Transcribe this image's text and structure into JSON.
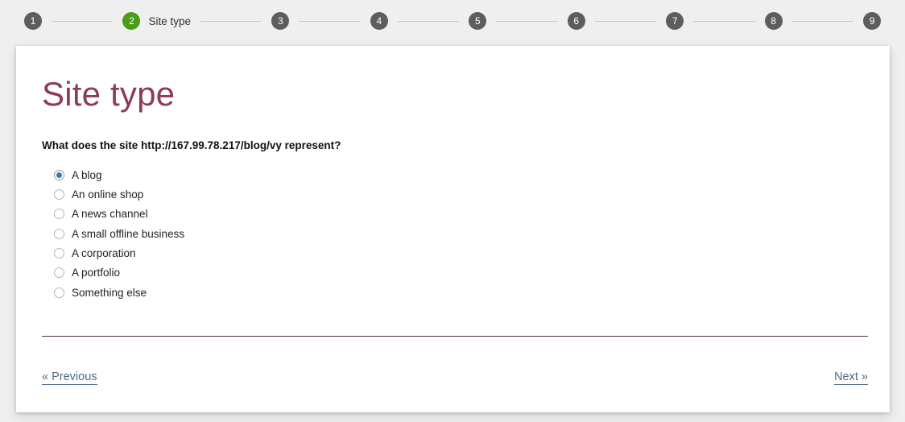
{
  "stepbar": {
    "steps": [
      {
        "number": "1",
        "label": "",
        "state": "pending"
      },
      {
        "number": "2",
        "label": "Site type",
        "state": "active"
      },
      {
        "number": "3",
        "label": "",
        "state": "pending"
      },
      {
        "number": "4",
        "label": "",
        "state": "pending"
      },
      {
        "number": "5",
        "label": "",
        "state": "pending"
      },
      {
        "number": "6",
        "label": "",
        "state": "pending"
      },
      {
        "number": "7",
        "label": "",
        "state": "pending"
      },
      {
        "number": "8",
        "label": "",
        "state": "pending"
      },
      {
        "number": "9",
        "label": "",
        "state": "pending"
      }
    ],
    "active_color": "#4b9c17",
    "pending_color": "#5d5d5d"
  },
  "main": {
    "title": "Site type",
    "title_color": "#8e3a5b",
    "question": "What does the site http://167.99.78.217/blog/vy represent?",
    "options": [
      {
        "label": "A blog",
        "selected": true
      },
      {
        "label": "An online shop",
        "selected": false
      },
      {
        "label": "A news channel",
        "selected": false
      },
      {
        "label": "A small offline business",
        "selected": false
      },
      {
        "label": "A corporation",
        "selected": false
      },
      {
        "label": "A portfolio",
        "selected": false
      },
      {
        "label": "Something else",
        "selected": false
      }
    ],
    "selected_radio_color": "#3a7ab5",
    "divider_color": "#5f2c44"
  },
  "footer": {
    "previous_label": "« Previous",
    "next_label": "Next »",
    "link_color": "#4b6b88"
  }
}
